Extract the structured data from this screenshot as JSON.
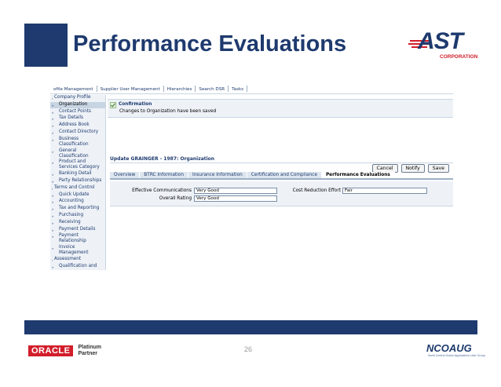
{
  "slide": {
    "title": "Performance Evaluations",
    "page_number": "26",
    "ast_logo": {
      "letters": "AST",
      "tagline": "CORPORATION"
    },
    "oracle_logo": {
      "brand": "ORACLE",
      "line1": "Platinum",
      "line2": "Partner"
    },
    "ncoaug_logo": {
      "name": "NCOAUG",
      "sub": "North Central Oracle Applications User Group"
    },
    "colors": {
      "navy": "#1e3a6e",
      "red": "#d21e2b"
    }
  },
  "app": {
    "topnav": [
      "ofile Management",
      "Supplier User Management",
      "Hierarchies",
      "Search DSR",
      "Tasks"
    ],
    "leftnav": [
      {
        "label": "Company Profile",
        "type": "section"
      },
      {
        "label": "Organization",
        "type": "item",
        "selected": true
      },
      {
        "label": "Contact Points",
        "type": "item"
      },
      {
        "label": "Tax Details",
        "type": "item"
      },
      {
        "label": "Address Book",
        "type": "item"
      },
      {
        "label": "Contact Directory",
        "type": "item"
      },
      {
        "label": "Business Classification",
        "type": "item"
      },
      {
        "label": "General Classification",
        "type": "item"
      },
      {
        "label": "Product and Services Category",
        "type": "item"
      },
      {
        "label": "Banking Detail",
        "type": "item"
      },
      {
        "label": "Party Relationships",
        "type": "item"
      },
      {
        "label": "Terms and Control",
        "type": "section"
      },
      {
        "label": "Quick Update",
        "type": "item"
      },
      {
        "label": "Accounting",
        "type": "item"
      },
      {
        "label": "Tax and Reporting",
        "type": "item"
      },
      {
        "label": "Purchasing",
        "type": "item"
      },
      {
        "label": "Receiving",
        "type": "item"
      },
      {
        "label": "Payment Details",
        "type": "item"
      },
      {
        "label": "Payment Relationship",
        "type": "item"
      },
      {
        "label": "Invoice Management",
        "type": "item"
      },
      {
        "label": "Assessment",
        "type": "section"
      },
      {
        "label": "Qualification and",
        "type": "item"
      }
    ],
    "confirmation": {
      "title": "Confirmation",
      "message": "Changes to Organization have been saved"
    },
    "update_title": "Update GRAINGER - 1987: Organization",
    "buttons": {
      "cancel": "Cancel",
      "notify": "Notify",
      "save": "Save"
    },
    "tabs": [
      {
        "label": "Overview",
        "active": false
      },
      {
        "label": "BTRC Information",
        "active": false
      },
      {
        "label": "Insurance Information",
        "active": false
      },
      {
        "label": "Certification and Compliance",
        "active": false
      },
      {
        "label": "Performance Evaluations",
        "active": true
      }
    ],
    "form": {
      "effective_communications": {
        "label": "Effective Communications",
        "value": "Very Good"
      },
      "overall_rating": {
        "label": "Overall Rating",
        "value": "Very Good"
      },
      "cost_reduction_effort": {
        "label": "Cost Reduction Effort",
        "value": "Fair"
      }
    }
  }
}
